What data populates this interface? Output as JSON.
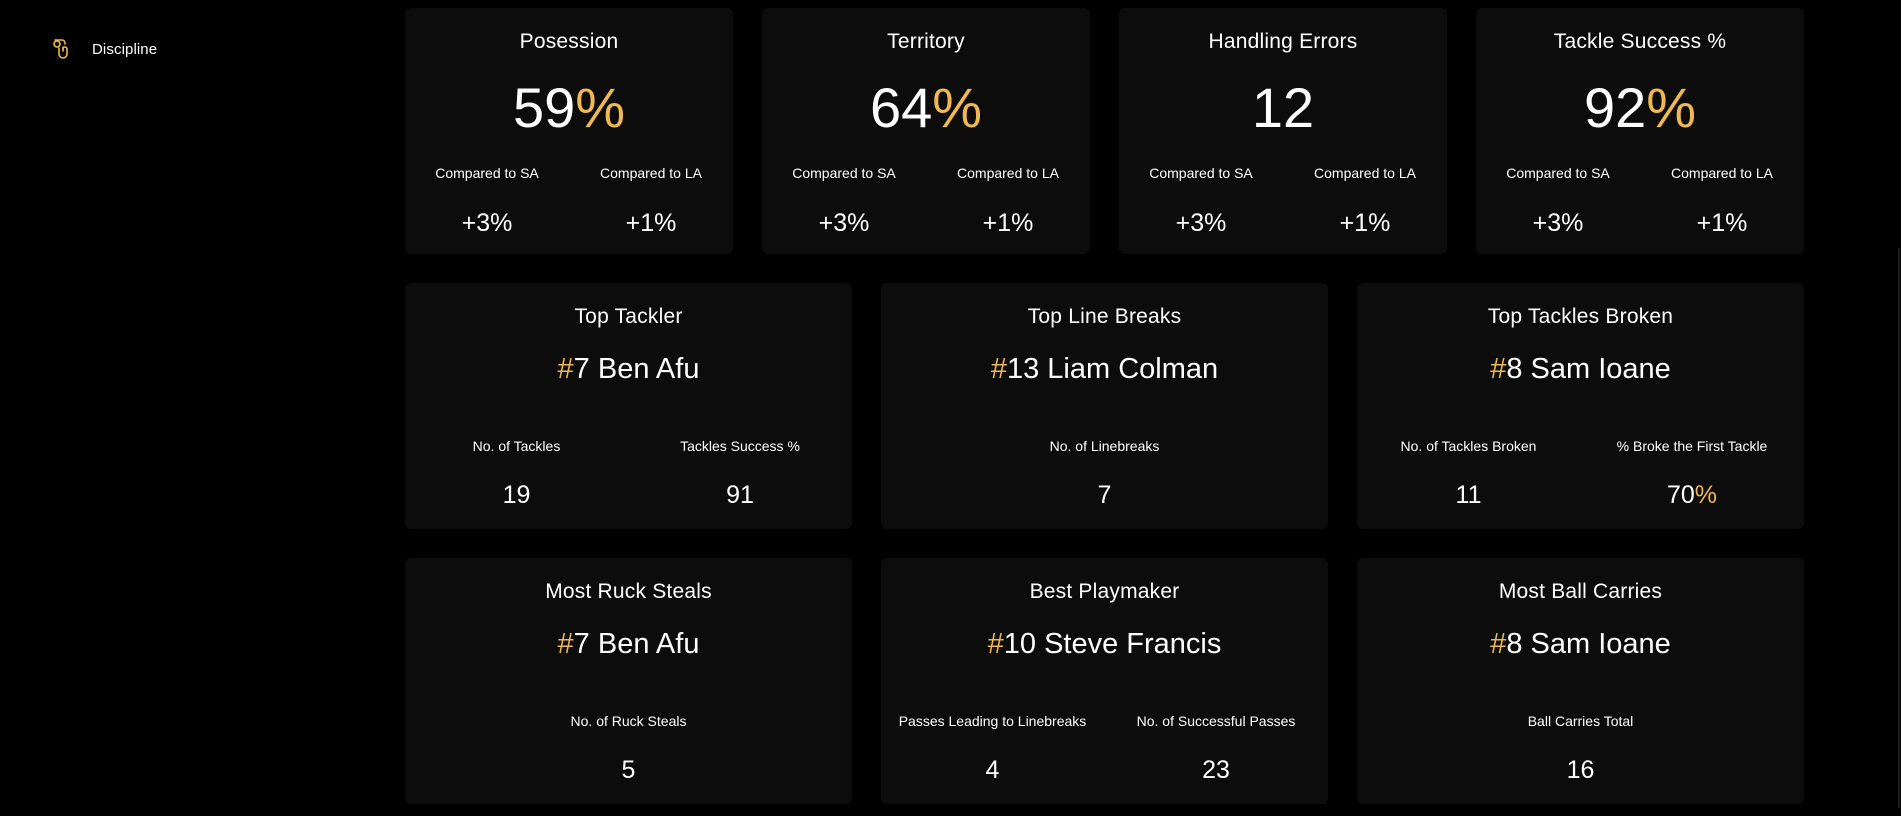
{
  "sidebar": {
    "items": [
      {
        "label": "Discipline",
        "icon": "whistle-icon"
      }
    ]
  },
  "colors": {
    "accent": "#f0b94f",
    "positive": "#5a9a36",
    "card_bg": "#0c0c0c",
    "page_bg": "#000000"
  },
  "stats": [
    {
      "title": "Posession",
      "value": "59",
      "suffix": "%",
      "compare_sa_label": "Compared to SA",
      "compare_sa_value": "+3%",
      "compare_la_label": "Compared to LA",
      "compare_la_value": "+1%"
    },
    {
      "title": "Territory",
      "value": "64",
      "suffix": "%",
      "compare_sa_label": "Compared to SA",
      "compare_sa_value": "+3%",
      "compare_la_label": "Compared to LA",
      "compare_la_value": "+1%"
    },
    {
      "title": "Handling Errors",
      "value": "12",
      "suffix": "",
      "compare_sa_label": "Compared to SA",
      "compare_sa_value": "+3%",
      "compare_la_label": "Compared to LA",
      "compare_la_value": "+1%"
    },
    {
      "title": "Tackle Success %",
      "value": "92",
      "suffix": "%",
      "compare_sa_label": "Compared to SA",
      "compare_sa_value": "+3%",
      "compare_la_label": "Compared to LA",
      "compare_la_value": "+1%"
    }
  ],
  "players": [
    {
      "title": "Top Tackler",
      "hash": "#",
      "player": "7 Ben Afu",
      "metrics": [
        {
          "label": "No. of Tackles",
          "value": "19",
          "suffix": ""
        },
        {
          "label": "Tackles Success %",
          "value": "91",
          "suffix": ""
        }
      ]
    },
    {
      "title": "Top Line Breaks",
      "hash": "#",
      "player": "13 Liam Colman",
      "metrics": [
        {
          "label": "No. of Linebreaks",
          "value": "7",
          "suffix": ""
        }
      ]
    },
    {
      "title": "Top Tackles Broken",
      "hash": "#",
      "player": "8 Sam Ioane",
      "metrics": [
        {
          "label": "No. of Tackles Broken",
          "value": "11",
          "suffix": ""
        },
        {
          "label": "% Broke the First Tackle",
          "value": "70",
          "suffix": "%"
        }
      ]
    },
    {
      "title": "Most Ruck Steals",
      "hash": "#",
      "player": "7 Ben Afu",
      "metrics": [
        {
          "label": "No. of Ruck Steals",
          "value": "5",
          "suffix": ""
        }
      ]
    },
    {
      "title": "Best Playmaker",
      "hash": "#",
      "player": "10 Steve Francis",
      "metrics": [
        {
          "label": "Passes Leading to Linebreaks",
          "value": "4",
          "suffix": ""
        },
        {
          "label": "No. of Successful Passes",
          "value": "23",
          "suffix": ""
        }
      ]
    },
    {
      "title": "Most Ball Carries",
      "hash": "#",
      "player": "8 Sam Ioane",
      "metrics": [
        {
          "label": "Ball Carries Total",
          "value": "16",
          "suffix": ""
        }
      ]
    }
  ]
}
